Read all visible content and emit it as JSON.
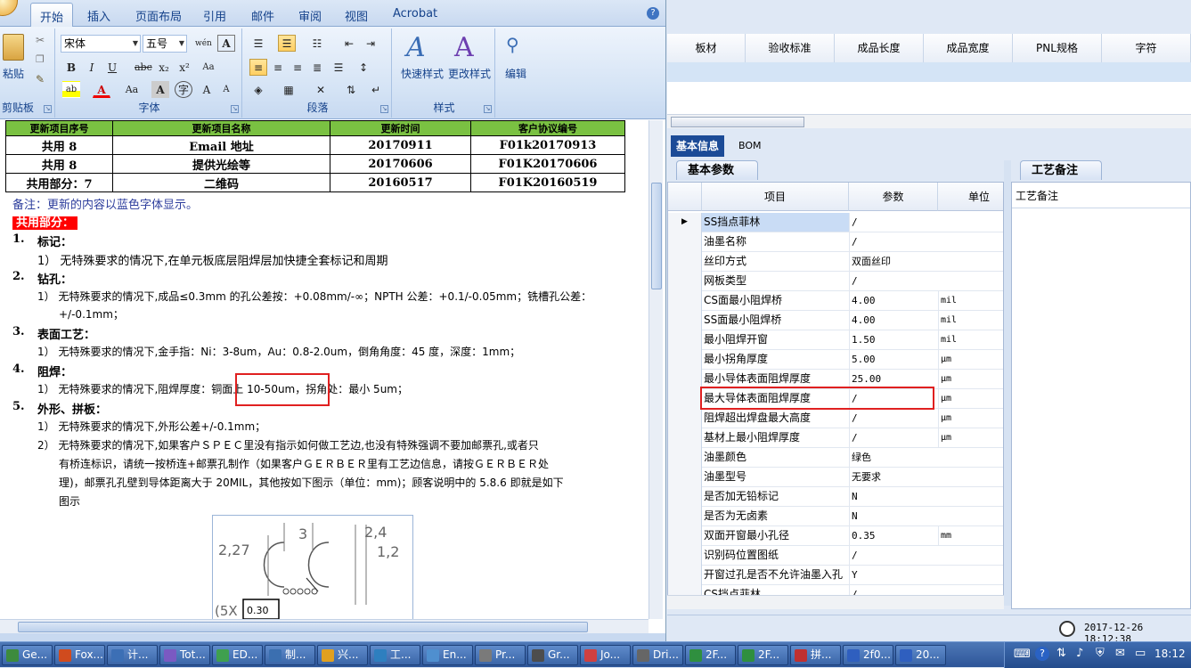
{
  "word": {
    "tabs": [
      "开始",
      "插入",
      "页面布局",
      "引用",
      "邮件",
      "审阅",
      "视图",
      "Acrobat"
    ],
    "active_tab": "开始",
    "ribbon": {
      "paste_label": "粘贴",
      "clipboard_label": "剪贴板",
      "font_name": "宋体",
      "font_size": "五号",
      "font_group_label": "字体",
      "paragraph_label": "段落",
      "quick_style_label": "快速样式",
      "change_style_label": "更改样式",
      "styles_label": "样式",
      "edit_label": "编辑"
    },
    "table": {
      "header": [
        "更新项目序号",
        "更新项目名称",
        "更新时间",
        "客户协议编号"
      ],
      "rows": [
        [
          "共用 8",
          "Email 地址",
          "20170911",
          "F01k20170913"
        ],
        [
          "共用 8",
          "提供光绘等",
          "20170606",
          "F01K20170606"
        ],
        [
          "共用部分：7",
          "二维码",
          "20160517",
          "F01K20160519"
        ]
      ]
    },
    "note": "备注：更新的内容以蓝色字体显示。",
    "shared_heading": "共用部分：",
    "sections": [
      {
        "num": "1.",
        "title": "标记：",
        "items": [
          "1） 无特殊要求的情况下,在单元板底层阻焊层加快捷全套标记和周期"
        ]
      },
      {
        "num": "2.",
        "title": "钻孔：",
        "items": [
          "1） 无特殊要求的情况下,成品≤0.3mm 的孔公差按：+0.08mm/-∞；NPTH 公差：+0.1/-0.05mm；铣槽孔公差：",
          "+/-0.1mm；"
        ]
      },
      {
        "num": "3.",
        "title": "表面工艺：",
        "items": [
          "1） 无特殊要求的情况下,金手指：Ni：3-8um，Au：0.8-2.0um，倒角角度：45 度，深度：1mm；"
        ]
      },
      {
        "num": "4.",
        "title": "阻焊：",
        "items": [
          "1） 无特殊要求的情况下,阻焊厚度：铜面上 10-50um，拐角处：最小 5um；"
        ]
      },
      {
        "num": "5.",
        "title": "外形、拼板：",
        "items": [
          "1） 无特殊要求的情况下,外形公差+/-0.1mm；",
          "2） 无特殊要求的情况下,如果客户ＳＰＥＣ里没有指示如何做工艺边,也没有特殊强调不要加邮票孔,或者只",
          "有桥连标识，请统一按桥连+邮票孔制作（如果客户ＧＥＲＢＥＲ里有工艺边信息，请按ＧＥＲＢＥＲ处",
          "理)，邮票孔孔壁到导体距离大于 20MIL，其他按如下图示（单位：mm)；顾客说明中的 5.8.6 即就是如下",
          "图示"
        ]
      }
    ],
    "figure_labels": [
      "2,27",
      "3",
      "2,4",
      "1,2",
      "(5X",
      "0.30"
    ]
  },
  "erp": {
    "columns": [
      "板材",
      "验收标准",
      "成品长度",
      "成品宽度",
      "PNL规格",
      "字符"
    ],
    "tabs": [
      "基本信息",
      "BOM"
    ],
    "param_tab": "基本参数",
    "note_tab": "工艺备注",
    "note_header": "工艺备注",
    "param_headers": [
      "项目",
      "参数",
      "单位"
    ],
    "params": [
      {
        "item": "SS挡点菲林",
        "value": "/",
        "unit": ""
      },
      {
        "item": "油墨名称",
        "value": "/",
        "unit": ""
      },
      {
        "item": "丝印方式",
        "value": "双面丝印",
        "unit": ""
      },
      {
        "item": "网板类型",
        "value": "/",
        "unit": ""
      },
      {
        "item": "CS面最小阻焊桥",
        "value": "4.00",
        "unit": "mil"
      },
      {
        "item": "SS面最小阻焊桥",
        "value": "4.00",
        "unit": "mil"
      },
      {
        "item": "最小阻焊开窗",
        "value": "1.50",
        "unit": "mil"
      },
      {
        "item": "最小拐角厚度",
        "value": "5.00",
        "unit": "μm"
      },
      {
        "item": "最小导体表面阻焊厚度",
        "value": "25.00",
        "unit": "μm"
      },
      {
        "item": "最大导体表面阻焊厚度",
        "value": "/",
        "unit": "μm"
      },
      {
        "item": "阻焊超出焊盘最大高度",
        "value": "/",
        "unit": "μm"
      },
      {
        "item": "基材上最小阻焊厚度",
        "value": "/",
        "unit": "μm"
      },
      {
        "item": "油墨颜色",
        "value": "绿色",
        "unit": ""
      },
      {
        "item": "油墨型号",
        "value": "无要求",
        "unit": ""
      },
      {
        "item": "是否加无铅标记",
        "value": "N",
        "unit": ""
      },
      {
        "item": "是否为无卤素",
        "value": "N",
        "unit": ""
      },
      {
        "item": "双面开窗最小孔径",
        "value": "0.35",
        "unit": "mm"
      },
      {
        "item": "识别码位置图纸",
        "value": "/",
        "unit": ""
      },
      {
        "item": "开窗过孔是否不允许油墨入孔",
        "value": "Y",
        "unit": ""
      },
      {
        "item": "CS挡点菲林",
        "value": "/",
        "unit": ""
      }
    ],
    "datetime": "2017-12-26  18:12:38"
  },
  "taskbar": {
    "tasks": [
      "Ge...",
      "Fox...",
      "计...",
      "Tot...",
      "ED...",
      "制...",
      "兴...",
      "工...",
      "En...",
      "Pr...",
      "Gr...",
      "Jo...",
      "Dri...",
      "2F...",
      "2F...",
      "拼...",
      "2f0...",
      "20..."
    ],
    "clock": "18:12"
  }
}
